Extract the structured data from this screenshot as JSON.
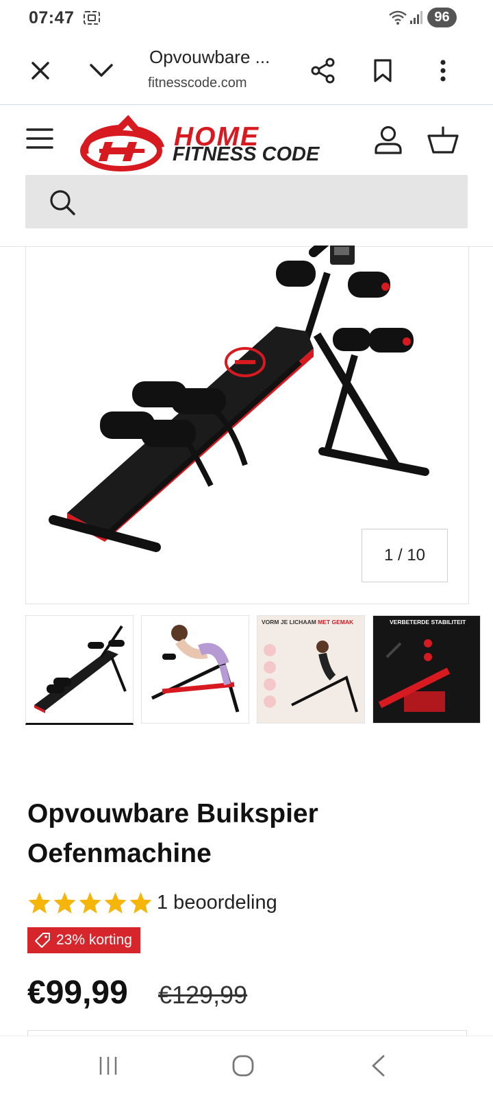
{
  "status_bar": {
    "time": "07:47",
    "battery": "96",
    "signal_icon": "signal-icon",
    "wifi_icon": "wifi-icon"
  },
  "browser": {
    "tab_title": "Opvouwbare ...",
    "url": "fitnesscode.com"
  },
  "site": {
    "logo_line1": "HOME",
    "logo_line2": "FITNESS CODE",
    "brand_color": "#d71920"
  },
  "gallery": {
    "counter": "1 / 10",
    "thumb3_caption_a": "VORM JE LICHAAM ",
    "thumb3_caption_b": "MET GEMAK",
    "thumb4_caption": "VERBETERDE STABILITEIT"
  },
  "product": {
    "title": "Opvouwbare Buikspier Oefenmachine",
    "rating_count_text": "1 beoordeling",
    "stars": 5,
    "discount_badge": "23% korting",
    "price": "€99,99",
    "old_price": "€129,99",
    "star_color": "#f5b50a",
    "badge_color": "#d7262b"
  }
}
